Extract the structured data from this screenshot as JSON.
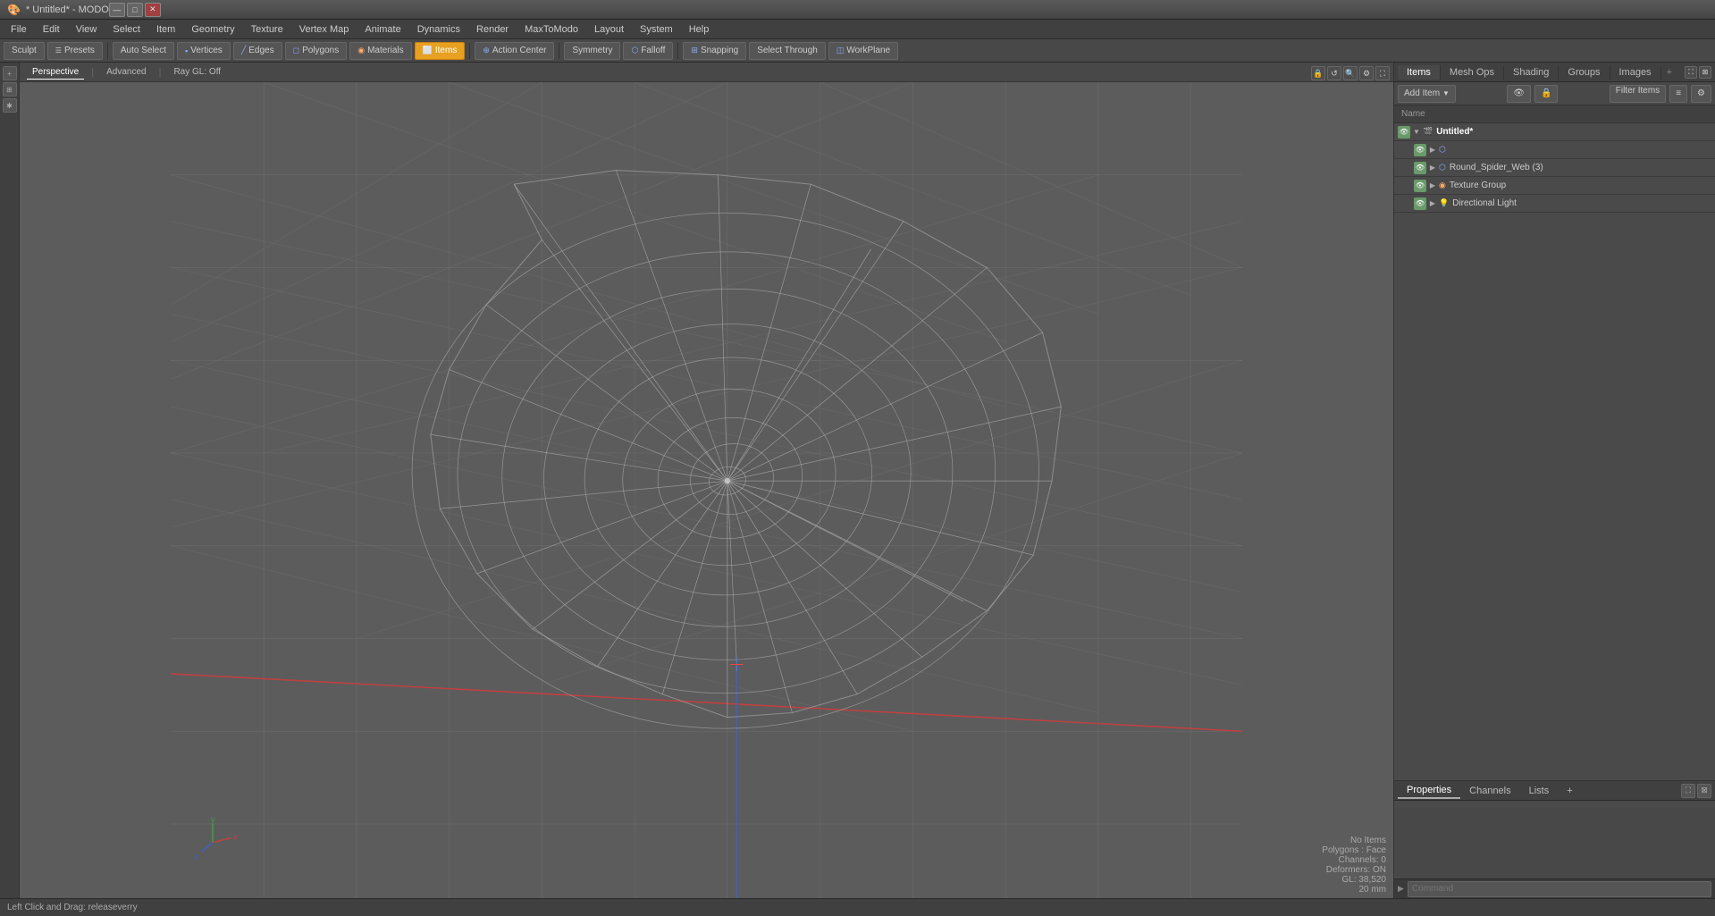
{
  "titlebar": {
    "title": "* Untitled* - MODO",
    "controls": {
      "minimize": "—",
      "maximize": "□",
      "close": "✕"
    }
  },
  "menubar": {
    "items": [
      "File",
      "Edit",
      "View",
      "Select",
      "Item",
      "Geometry",
      "Texture",
      "Vertex Map",
      "Animate",
      "Dynamics",
      "Render",
      "MaxToModo",
      "Layout",
      "System",
      "Help"
    ]
  },
  "toolbar": {
    "sculpt_label": "Sculpt",
    "presets_label": "Presets",
    "auto_select_label": "Auto Select",
    "vertices_label": "Vertices",
    "edges_label": "Edges",
    "polygons_label": "Polygons",
    "materials_label": "Materials",
    "items_label": "Items",
    "action_center_label": "Action Center",
    "symmetry_label": "Symmetry",
    "falloff_label": "Falloff",
    "snapping_label": "Snapping",
    "select_through_label": "Select Through",
    "workplane_label": "WorkPlane"
  },
  "viewport": {
    "tabs": [
      "Perspective",
      "Advanced"
    ],
    "ray_gl": "Ray GL: Off",
    "status": {
      "no_items": "No Items",
      "polygons_face": "Polygons : Face",
      "channels": "Channels: 0",
      "deformers": "Deformers: ON",
      "gl": "GL: 38,520",
      "unit": "20 mm"
    }
  },
  "items_panel": {
    "tabs": [
      "Items",
      "Mesh Ops",
      "Shading",
      "Groups",
      "Images"
    ],
    "add_tab": "+",
    "toolbar": {
      "add_item": "Add Item",
      "dropdown_arrow": "▼",
      "eye_icon": "👁",
      "lock_icon": "🔒",
      "filter_items": "Filter Items",
      "filter_icon": "≡",
      "settings_icon": "⚙"
    },
    "header": {
      "name_label": "Name"
    },
    "tree": [
      {
        "id": "untitled",
        "name": "Untitled*",
        "indent": 0,
        "expanded": true,
        "icon": "scene",
        "has_vis": true
      },
      {
        "id": "sublayer",
        "name": "",
        "indent": 1,
        "expanded": false,
        "icon": "mesh",
        "has_vis": true
      },
      {
        "id": "round_spider_web",
        "name": "Round_Spider_Web (3)",
        "indent": 1,
        "expanded": false,
        "icon": "mesh",
        "has_vis": true
      },
      {
        "id": "texture_group",
        "name": "Texture Group",
        "indent": 1,
        "expanded": false,
        "icon": "texture",
        "has_vis": true
      },
      {
        "id": "directional_light",
        "name": "Directional Light",
        "indent": 1,
        "expanded": false,
        "icon": "light",
        "has_vis": true
      }
    ]
  },
  "bottom_panel": {
    "tabs": [
      "Properties",
      "Channels",
      "Lists"
    ],
    "add_tab": "+",
    "command_placeholder": "Command"
  },
  "statusbar": {
    "message": "Left Click and Drag:  releaseverry"
  }
}
